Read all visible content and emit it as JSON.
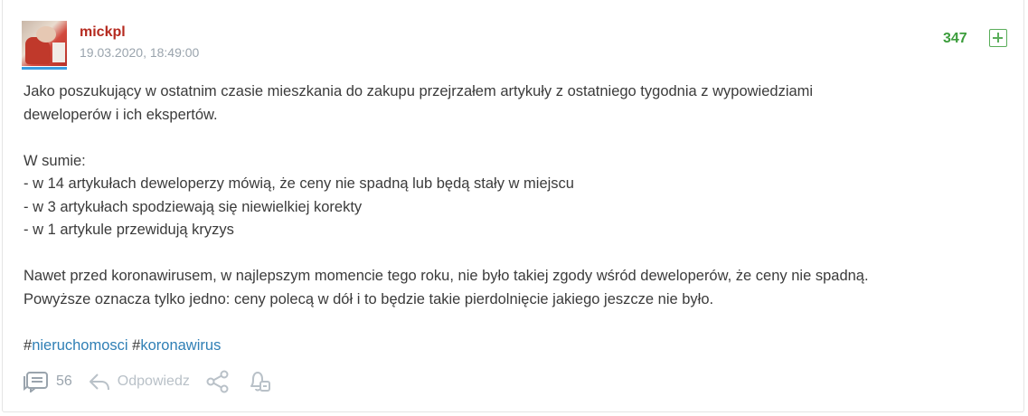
{
  "post": {
    "author": "mickpl",
    "date": "19.03.2020, 18:49:00",
    "votes": "347",
    "body": {
      "para1_line1": "Jako poszukujący w ostatnim czasie mieszkania do zakupu przejrzałem artykuły z ostatniego tygodnia z wypowiedziami",
      "para1_line2": "deweloperów i ich ekspertów.",
      "summary_heading": "W sumie:",
      "items": [
        "- w 14 artykułach deweloperzy mówią, że ceny nie spadną lub będą stały w miejscu",
        "- w 3 artykułach spodziewają się niewielkiej korekty",
        "- w 1 artykule przewidują kryzys"
      ],
      "para3_line1": "Nawet przed koronawirusem, w najlepszym momencie tego roku, nie było takiej zgody wśród deweloperów, że ceny nie spadną.",
      "para3_line2": "Powyższe oznacza tylko jedno: ceny polecą w dół i to będzie takie pierdolnięcie jakiego jeszcze nie było."
    },
    "tags": [
      {
        "hash": "#",
        "name": "nieruchomosci"
      },
      {
        "hash": "#",
        "name": "koronawirus"
      }
    ],
    "actions": {
      "comments_count": "56",
      "reply_label": "Odpowiedz"
    },
    "icons": {
      "comments": "comments-icon",
      "reply": "reply-icon",
      "share": "share-icon",
      "notify": "bell-icon",
      "vote": "plus-icon"
    },
    "colors": {
      "author": "#b52a1f",
      "votes": "#3c9d3c",
      "tag": "#2f7fb5",
      "muted": "#9aa4ad"
    }
  }
}
